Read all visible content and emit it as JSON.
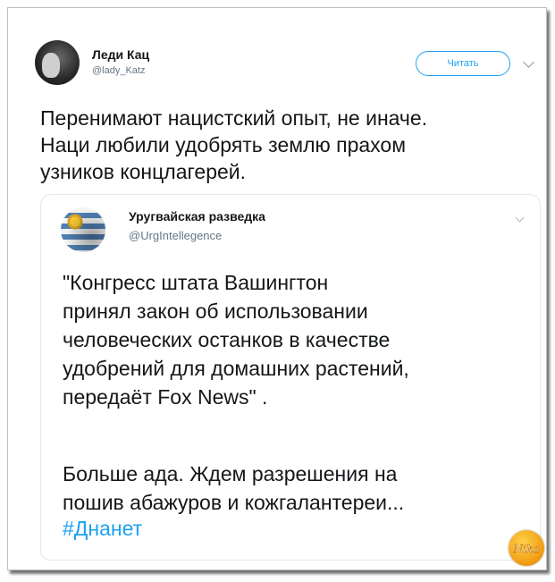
{
  "tweet": {
    "author": {
      "name": "Леди Кац",
      "handle": "@lady_Katz"
    },
    "follow_label": "Читать",
    "text": "Перенимают нацистский опыт, не иначе.\nНаци любили удобрять землю прахом\nузников концлагерей."
  },
  "quote": {
    "author": {
      "name": "Уругвайская разведка",
      "handle": "@UrgIntellegence"
    },
    "text": "\"Конгресс штата Вашингтон\nпринял закон об использовании\nчеловеческих останков в качестве\nудобрений для домашних растений,\nпередаёт Fox News\" .",
    "text2": "Больше ада. Ждем разрешения на\nпошив абажуров и кожгалантереи...",
    "hashtag": "#Днанет"
  },
  "watermark": {
    "text": "Nika"
  },
  "colors": {
    "accent": "#1da1f2",
    "text": "#14171a",
    "muted": "#657786",
    "border": "#e1e8ed"
  },
  "icons": {
    "more_main": "chevron-down-icon",
    "more_quote": "chevron-down-icon"
  }
}
